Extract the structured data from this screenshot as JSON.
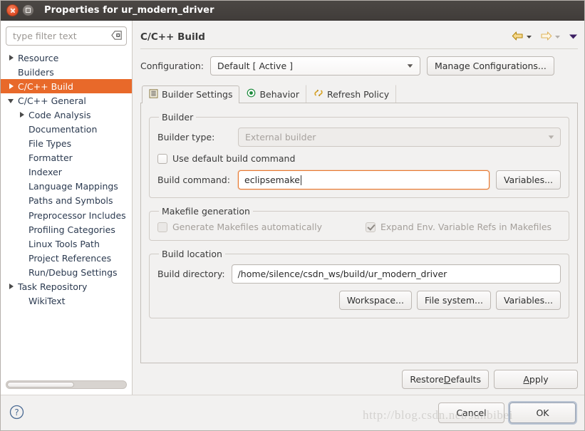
{
  "window": {
    "title": "Properties for ur_modern_driver",
    "close_icon": "close-icon",
    "maximize_icon": "maximize-icon"
  },
  "sidebar": {
    "filter": {
      "placeholder": "type filter text",
      "value": "",
      "clear_icon": "clear-icon"
    },
    "items": [
      {
        "label": "Resource",
        "indent": 0,
        "twisty": "right",
        "selected": false
      },
      {
        "label": "Builders",
        "indent": 0,
        "twisty": "none",
        "selected": false
      },
      {
        "label": "C/C++ Build",
        "indent": 0,
        "twisty": "right",
        "selected": true
      },
      {
        "label": "C/C++ General",
        "indent": 0,
        "twisty": "down",
        "selected": false
      },
      {
        "label": "Code Analysis",
        "indent": 1,
        "twisty": "right",
        "selected": false
      },
      {
        "label": "Documentation",
        "indent": 1,
        "twisty": "none",
        "selected": false
      },
      {
        "label": "File Types",
        "indent": 1,
        "twisty": "none",
        "selected": false
      },
      {
        "label": "Formatter",
        "indent": 1,
        "twisty": "none",
        "selected": false
      },
      {
        "label": "Indexer",
        "indent": 1,
        "twisty": "none",
        "selected": false
      },
      {
        "label": "Language Mappings",
        "indent": 1,
        "twisty": "none",
        "selected": false
      },
      {
        "label": "Paths and Symbols",
        "indent": 1,
        "twisty": "none",
        "selected": false
      },
      {
        "label": "Preprocessor Includes",
        "indent": 1,
        "twisty": "none",
        "selected": false
      },
      {
        "label": "Profiling Categories",
        "indent": 1,
        "twisty": "none",
        "selected": false
      },
      {
        "label": "Linux Tools Path",
        "indent": 0,
        "twisty": "none",
        "selected": false
      },
      {
        "label": "Project References",
        "indent": 0,
        "twisty": "none",
        "selected": false
      },
      {
        "label": "Run/Debug Settings",
        "indent": 0,
        "twisty": "none",
        "selected": false
      },
      {
        "label": "Task Repository",
        "indent": 0,
        "twisty": "right",
        "selected": false
      },
      {
        "label": "WikiText",
        "indent": 0,
        "twisty": "none",
        "selected": false
      }
    ]
  },
  "page": {
    "title": "C/C++ Build",
    "nav": {
      "back_icon": "back-arrow-icon",
      "back_menu_icon": "chevron-down-icon",
      "forward_icon": "forward-arrow-icon",
      "forward_menu_icon": "chevron-down-icon",
      "view_menu_icon": "view-menu-icon"
    },
    "configuration": {
      "label": "Configuration:",
      "value": "Default  [ Active ]",
      "manage_button": "Manage Configurations..."
    },
    "tabs": [
      {
        "label": "Builder Settings",
        "icon": "builder-settings-icon",
        "active": true
      },
      {
        "label": "Behavior",
        "icon": "behavior-icon",
        "active": false
      },
      {
        "label": "Refresh Policy",
        "icon": "refresh-policy-icon",
        "active": false
      }
    ],
    "builder_group": {
      "legend": "Builder",
      "builder_type_label": "Builder type:",
      "builder_type_value": "External builder",
      "use_default_checkbox": {
        "label": "Use default build command",
        "checked": false
      },
      "build_command_label": "Build command:",
      "build_command_value": "eclipsemake",
      "variables_button": "Variables..."
    },
    "makefile_group": {
      "legend": "Makefile generation",
      "generate_checkbox": {
        "label": "Generate Makefiles automatically",
        "checked": false
      },
      "expand_checkbox": {
        "label": "Expand Env. Variable Refs in Makefiles",
        "checked": true
      }
    },
    "build_location_group": {
      "legend": "Build location",
      "build_directory_label": "Build directory:",
      "build_directory_value": "/home/silence/csdn_ws/build/ur_modern_driver",
      "workspace_button": "Workspace...",
      "filesystem_button": "File system...",
      "variables_button": "Variables..."
    },
    "restore_defaults_button": "Restore Defaults",
    "restore_defaults_mnemonic": "D",
    "apply_button": "Apply",
    "apply_mnemonic": "A"
  },
  "footer": {
    "help_icon": "help-icon",
    "cancel_button": "Cancel",
    "ok_button": "OK"
  },
  "watermark": "http://blog.csdn.net/sunbibei",
  "colors": {
    "selection": "#e8692a",
    "focus_border": "#e8782f",
    "titlebar": "#413d3a",
    "close_button": "#e2512a"
  }
}
